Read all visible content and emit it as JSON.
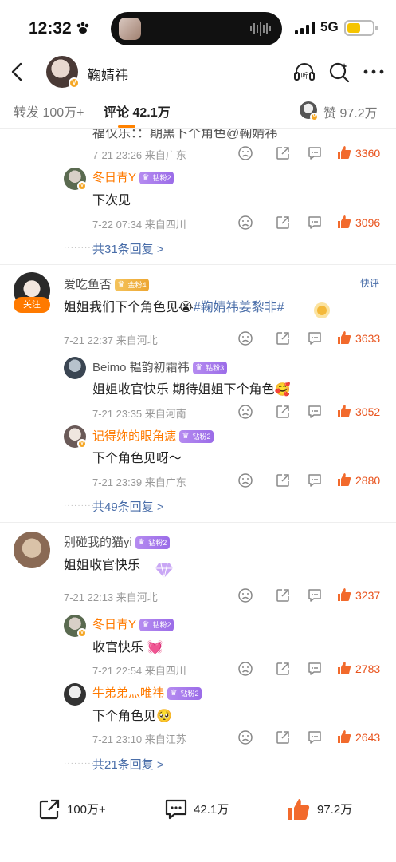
{
  "status_bar": {
    "time": "12:32",
    "network": "5G"
  },
  "header": {
    "name": "鞠婧祎"
  },
  "tabs": {
    "repost": "转发 100万+",
    "comments": "评论 42.1万",
    "likes": "赞 97.2万"
  },
  "truncated_reply": {
    "text": "福仅乐：：期黑卜个角色@鞠婧祎",
    "time": "7-21 23:26",
    "location": "来自广东",
    "likes": "3360"
  },
  "thread1": {
    "replies": [
      {
        "name": "冬日青Y",
        "badge": "钻粉2",
        "text": "下次见",
        "time": "7-22 07:34",
        "location": "来自四川",
        "likes": "3096"
      }
    ],
    "more": "共31条回复 >"
  },
  "comment2": {
    "name": "爱吃鱼否",
    "badge": "金粉4",
    "follow": "关注",
    "quick": "快评",
    "text": "姐姐我们下个角色见😭",
    "topic": "#鞠婧祎姜黎非#",
    "time": "7-21 22:37",
    "location": "来自河北",
    "likes": "3633",
    "replies": [
      {
        "name": "Beimo 韫韵初霜祎",
        "badge": "钻粉3",
        "text": "姐姐收官快乐 期待姐姐下个角色🥰",
        "time": "7-21 23:35",
        "location": "来自河南",
        "likes": "3052"
      },
      {
        "name": "记得妳的眼角痣",
        "badge": "钻粉2",
        "text": "下个角色见呀～",
        "time": "7-21 23:39",
        "location": "来自广东",
        "likes": "2880"
      }
    ],
    "more": "共49条回复 >"
  },
  "comment3": {
    "name": "别碰我的猫yi",
    "badge": "钻粉2",
    "text": "姐姐收官快乐",
    "time": "7-21 22:13",
    "location": "来自河北",
    "likes": "3237",
    "replies": [
      {
        "name": "冬日青Y",
        "badge": "钻粉2",
        "text": "收官快乐 💓",
        "time": "7-21 22:54",
        "location": "来自四川",
        "likes": "2783"
      },
      {
        "name": "牛弟弟灬唯祎",
        "badge": "钻粉2",
        "text": "下个角色见🥺",
        "time": "7-21 23:10",
        "location": "来自江苏",
        "likes": "2643"
      }
    ],
    "more": "共21条回复 >"
  },
  "bottom_bar": {
    "repost": "100万+",
    "comments": "42.1万",
    "likes": "97.2万"
  },
  "colors": {
    "accent": "#ff7a00",
    "like": "#e8531d",
    "link": "#4a6ea9",
    "badge_purple": "#9b6ce8",
    "badge_gold": "#eda632"
  }
}
